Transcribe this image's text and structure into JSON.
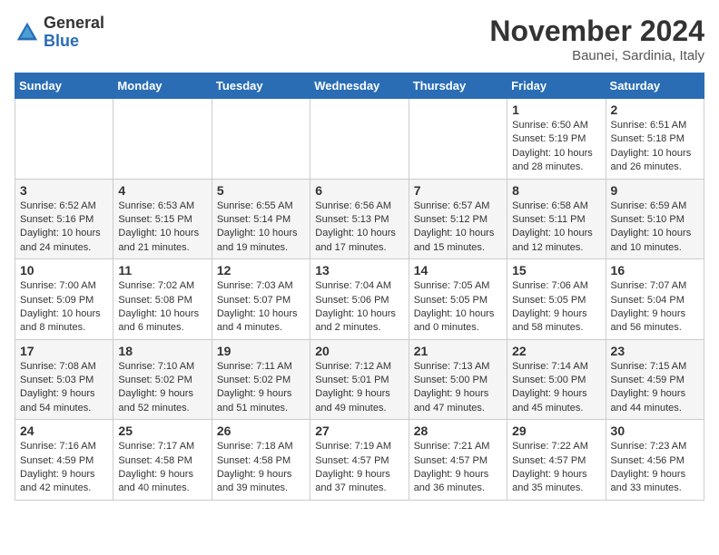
{
  "header": {
    "logo_general": "General",
    "logo_blue": "Blue",
    "month_title": "November 2024",
    "location": "Baunei, Sardinia, Italy"
  },
  "weekdays": [
    "Sunday",
    "Monday",
    "Tuesday",
    "Wednesday",
    "Thursday",
    "Friday",
    "Saturday"
  ],
  "weeks": [
    [
      {
        "day": "",
        "info": ""
      },
      {
        "day": "",
        "info": ""
      },
      {
        "day": "",
        "info": ""
      },
      {
        "day": "",
        "info": ""
      },
      {
        "day": "",
        "info": ""
      },
      {
        "day": "1",
        "info": "Sunrise: 6:50 AM\nSunset: 5:19 PM\nDaylight: 10 hours and 28 minutes."
      },
      {
        "day": "2",
        "info": "Sunrise: 6:51 AM\nSunset: 5:18 PM\nDaylight: 10 hours and 26 minutes."
      }
    ],
    [
      {
        "day": "3",
        "info": "Sunrise: 6:52 AM\nSunset: 5:16 PM\nDaylight: 10 hours and 24 minutes."
      },
      {
        "day": "4",
        "info": "Sunrise: 6:53 AM\nSunset: 5:15 PM\nDaylight: 10 hours and 21 minutes."
      },
      {
        "day": "5",
        "info": "Sunrise: 6:55 AM\nSunset: 5:14 PM\nDaylight: 10 hours and 19 minutes."
      },
      {
        "day": "6",
        "info": "Sunrise: 6:56 AM\nSunset: 5:13 PM\nDaylight: 10 hours and 17 minutes."
      },
      {
        "day": "7",
        "info": "Sunrise: 6:57 AM\nSunset: 5:12 PM\nDaylight: 10 hours and 15 minutes."
      },
      {
        "day": "8",
        "info": "Sunrise: 6:58 AM\nSunset: 5:11 PM\nDaylight: 10 hours and 12 minutes."
      },
      {
        "day": "9",
        "info": "Sunrise: 6:59 AM\nSunset: 5:10 PM\nDaylight: 10 hours and 10 minutes."
      }
    ],
    [
      {
        "day": "10",
        "info": "Sunrise: 7:00 AM\nSunset: 5:09 PM\nDaylight: 10 hours and 8 minutes."
      },
      {
        "day": "11",
        "info": "Sunrise: 7:02 AM\nSunset: 5:08 PM\nDaylight: 10 hours and 6 minutes."
      },
      {
        "day": "12",
        "info": "Sunrise: 7:03 AM\nSunset: 5:07 PM\nDaylight: 10 hours and 4 minutes."
      },
      {
        "day": "13",
        "info": "Sunrise: 7:04 AM\nSunset: 5:06 PM\nDaylight: 10 hours and 2 minutes."
      },
      {
        "day": "14",
        "info": "Sunrise: 7:05 AM\nSunset: 5:05 PM\nDaylight: 10 hours and 0 minutes."
      },
      {
        "day": "15",
        "info": "Sunrise: 7:06 AM\nSunset: 5:05 PM\nDaylight: 9 hours and 58 minutes."
      },
      {
        "day": "16",
        "info": "Sunrise: 7:07 AM\nSunset: 5:04 PM\nDaylight: 9 hours and 56 minutes."
      }
    ],
    [
      {
        "day": "17",
        "info": "Sunrise: 7:08 AM\nSunset: 5:03 PM\nDaylight: 9 hours and 54 minutes."
      },
      {
        "day": "18",
        "info": "Sunrise: 7:10 AM\nSunset: 5:02 PM\nDaylight: 9 hours and 52 minutes."
      },
      {
        "day": "19",
        "info": "Sunrise: 7:11 AM\nSunset: 5:02 PM\nDaylight: 9 hours and 51 minutes."
      },
      {
        "day": "20",
        "info": "Sunrise: 7:12 AM\nSunset: 5:01 PM\nDaylight: 9 hours and 49 minutes."
      },
      {
        "day": "21",
        "info": "Sunrise: 7:13 AM\nSunset: 5:00 PM\nDaylight: 9 hours and 47 minutes."
      },
      {
        "day": "22",
        "info": "Sunrise: 7:14 AM\nSunset: 5:00 PM\nDaylight: 9 hours and 45 minutes."
      },
      {
        "day": "23",
        "info": "Sunrise: 7:15 AM\nSunset: 4:59 PM\nDaylight: 9 hours and 44 minutes."
      }
    ],
    [
      {
        "day": "24",
        "info": "Sunrise: 7:16 AM\nSunset: 4:59 PM\nDaylight: 9 hours and 42 minutes."
      },
      {
        "day": "25",
        "info": "Sunrise: 7:17 AM\nSunset: 4:58 PM\nDaylight: 9 hours and 40 minutes."
      },
      {
        "day": "26",
        "info": "Sunrise: 7:18 AM\nSunset: 4:58 PM\nDaylight: 9 hours and 39 minutes."
      },
      {
        "day": "27",
        "info": "Sunrise: 7:19 AM\nSunset: 4:57 PM\nDaylight: 9 hours and 37 minutes."
      },
      {
        "day": "28",
        "info": "Sunrise: 7:21 AM\nSunset: 4:57 PM\nDaylight: 9 hours and 36 minutes."
      },
      {
        "day": "29",
        "info": "Sunrise: 7:22 AM\nSunset: 4:57 PM\nDaylight: 9 hours and 35 minutes."
      },
      {
        "day": "30",
        "info": "Sunrise: 7:23 AM\nSunset: 4:56 PM\nDaylight: 9 hours and 33 minutes."
      }
    ]
  ]
}
